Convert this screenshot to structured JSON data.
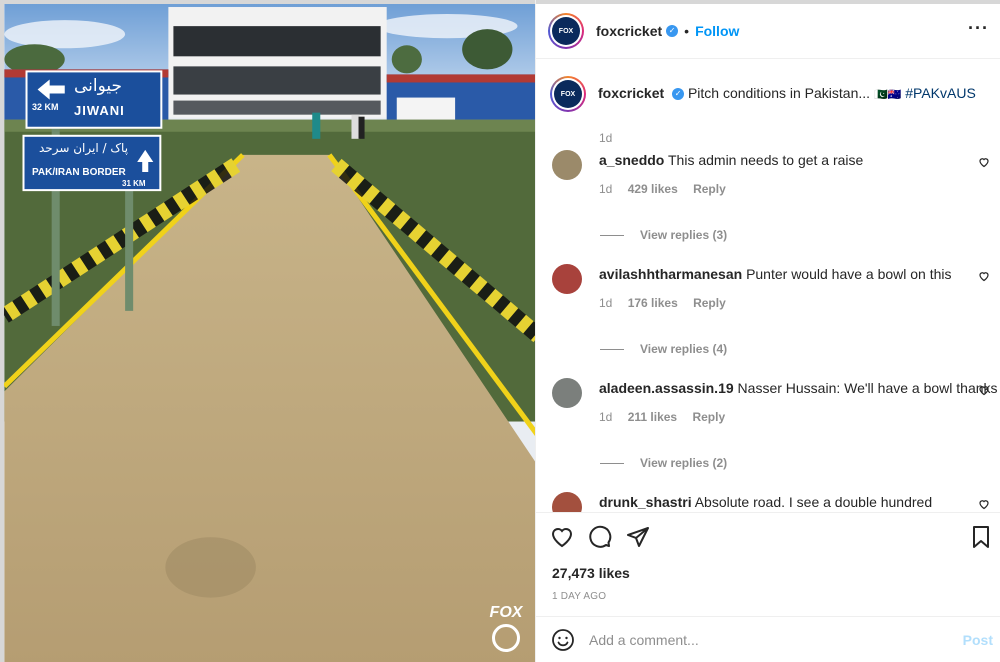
{
  "media": {
    "sign_top": {
      "urdu": "جیوانی",
      "km": "32 KM",
      "english": "JIWANI"
    },
    "sign_bottom": {
      "urdu": "پاک / ایران سرحد",
      "english": "PAK/IRAN BORDER",
      "km": "31 KM"
    },
    "watermark": "FOX"
  },
  "post": {
    "username": "foxcricket",
    "verified_icon": "verified-badge-icon",
    "follow_label": "Follow",
    "more_icon": "more-options-icon",
    "caption": {
      "username": "foxcricket",
      "text": "Pitch conditions in Pakistan...",
      "emoji": "🇵🇰🇦🇺",
      "hashtag": "#PAKvAUS",
      "time": "1d"
    }
  },
  "comments": [
    {
      "username": "a_sneddo",
      "text": "This admin needs to get a raise",
      "time": "1d",
      "likes": "429 likes",
      "reply": "Reply",
      "view_replies": "View replies (3)",
      "avatar_color": "#9b8a6a"
    },
    {
      "username": "avilashhtharmanesan",
      "text": "Punter would have a bowl on this",
      "time": "1d",
      "likes": "176 likes",
      "reply": "Reply",
      "view_replies": "View replies (4)",
      "avatar_color": "#a8423c"
    },
    {
      "username": "aladeen.assassin.19",
      "text": "Nasser Hussain: We'll have a bowl thanks",
      "time": "1d",
      "likes": "211 likes",
      "reply": "Reply",
      "view_replies": "View replies (2)",
      "avatar_color": "#7b7f7c"
    },
    {
      "username": "drunk_shastri",
      "text": "Absolute road. I see a double hundred",
      "avatar_color": "#a3503e"
    }
  ],
  "actions": {
    "likes": "27,473 likes",
    "time_ago": "1 DAY AGO"
  },
  "add_comment": {
    "placeholder": "Add a comment...",
    "post_label": "Post"
  },
  "colors": {
    "link": "#0095f6",
    "muted": "#8e8e8e",
    "post_disabled": "#b2dffc",
    "sign_blue": "#1b4f9c"
  }
}
